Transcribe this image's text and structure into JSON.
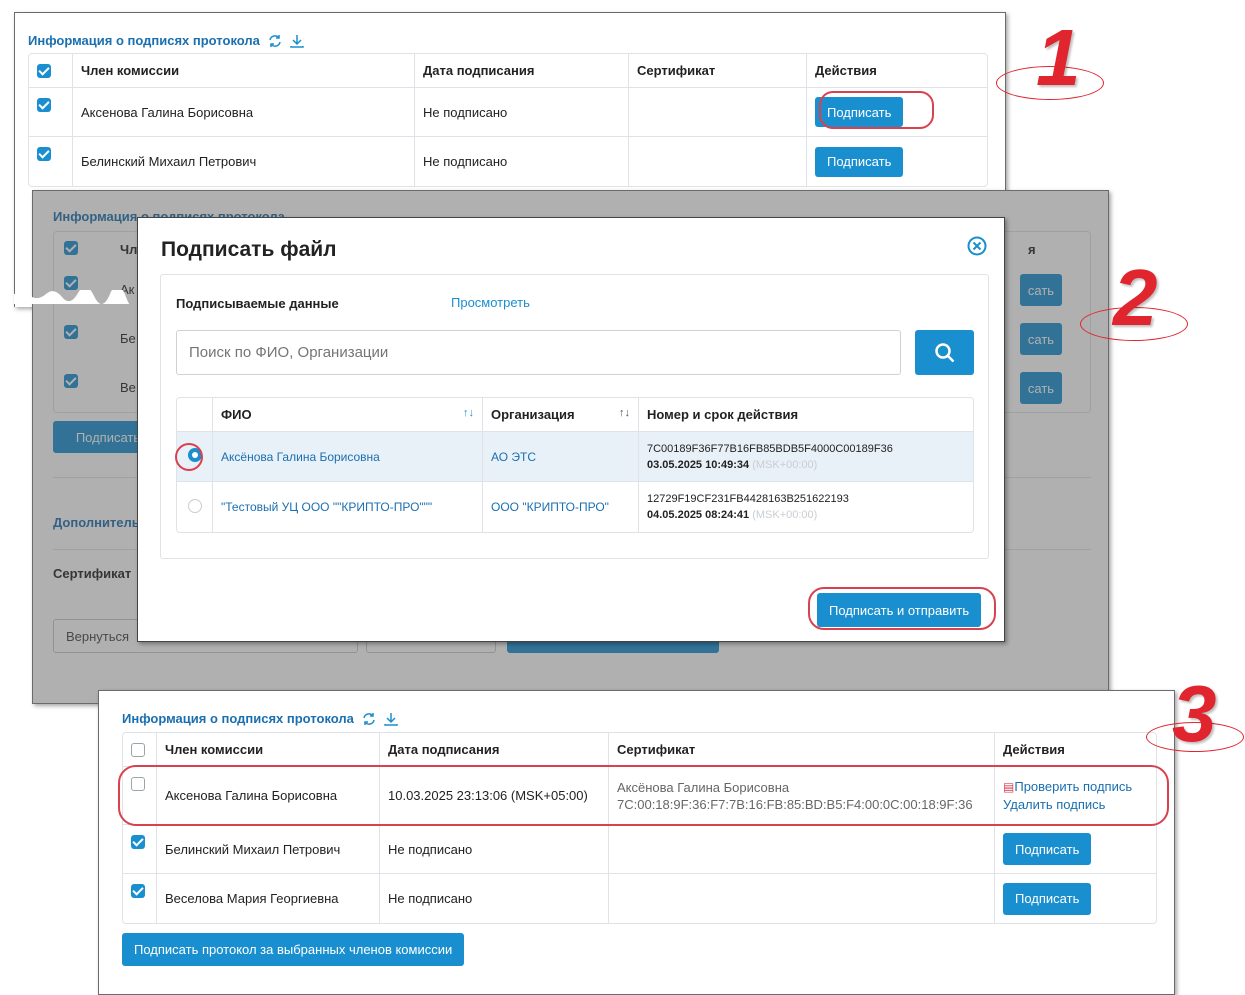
{
  "panel1": {
    "title": "Информация о подписях протокола",
    "columns": [
      "Член комиссии",
      "Дата подписания",
      "Сертификат",
      "Действия"
    ],
    "rows": [
      {
        "name": "Аксенова Галина Борисовна",
        "date": "Не подписано",
        "cert": "",
        "action": "Подписать"
      },
      {
        "name": "Белинский Михаил Петрович",
        "date": "Не подписано",
        "cert": "",
        "action": "Подписать"
      }
    ]
  },
  "panel2_bg": {
    "title": "Информация о подписях протокола",
    "col_first_partial": "Чл",
    "col_last_partial": "я",
    "row_partials": [
      "Ак",
      "Бе",
      "Ве"
    ],
    "action_partial": "сать",
    "sign_button": "Подписать",
    "additional_partial": "Дополнитель",
    "certificate_label": "Сертификат",
    "back_button": "Вернуться"
  },
  "dialog": {
    "title": "Подписать файл",
    "signed_data_label": "Подписываемые данные",
    "view_link": "Просмотреть",
    "search_placeholder": "Поиск по ФИО, Организации",
    "columns": [
      "ФИО",
      "Организация",
      "Номер и срок действия"
    ],
    "rows": [
      {
        "fio": "Аксёнова Галина Борисовна",
        "org": "АО ЭТС",
        "cert_number": "7C00189F36F77B16FB85BDB5F4000C00189F36",
        "valid_until": "03.05.2025 10:49:34",
        "tz": "(MSK+00:00)",
        "selected": true
      },
      {
        "fio": "\"Тестовый УЦ ООО \"\"КРИПТО-ПРО\"\"\"",
        "org": "ООО \"КРИПТО-ПРО\"",
        "cert_number": "12729F19CF231FB4428163B251622193",
        "valid_until": "04.05.2025 08:24:41",
        "tz": "(MSK+00:00)",
        "selected": false
      }
    ],
    "submit_button": "Подписать и отправить"
  },
  "panel3": {
    "title": "Информация о подписях протокола",
    "columns": [
      "Член комиссии",
      "Дата подписания",
      "Сертификат",
      "Действия"
    ],
    "rows": [
      {
        "name": "Аксенова Галина Борисовна",
        "date": "10.03.2025 23:13:06 (MSK+05:00)",
        "cert_name": "Аксёнова Галина Борисовна",
        "cert_serial": "7C:00:18:9F:36:F7:7B:16:FB:85:BD:B5:F4:00:0C:00:18:9F:36",
        "action_verify": "Проверить подпись",
        "action_delete": "Удалить подпись"
      },
      {
        "name": "Белинский Михаил Петрович",
        "date": "Не подписано",
        "action": "Подписать"
      },
      {
        "name": "Веселова Мария Георгиевна",
        "date": "Не подписано",
        "action": "Подписать"
      }
    ],
    "bulk_sign_button": "Подписать протокол за выбранных членов комиссии"
  },
  "step_numbers": [
    "1",
    "2",
    "3"
  ],
  "colors": {
    "accent": "#1a8fd0",
    "link": "#1a6fb0",
    "highlight": "#d9414f",
    "step_number": "#e0252f"
  }
}
